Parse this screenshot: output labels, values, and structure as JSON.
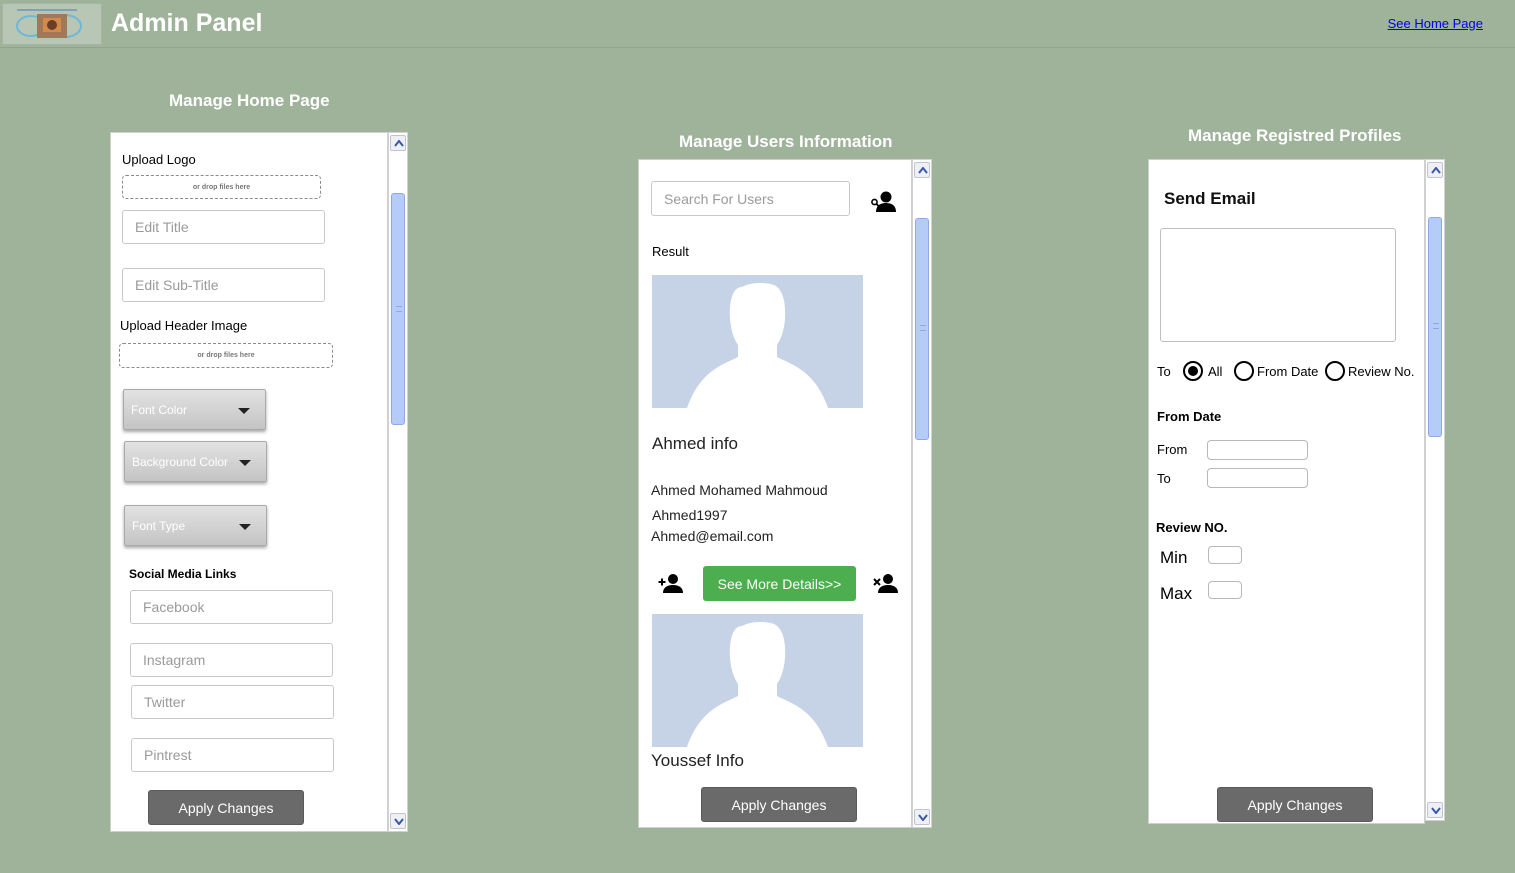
{
  "header": {
    "title": "Admin Panel",
    "home_link": "See Home Page"
  },
  "home_page": {
    "section_title": "Manage Home Page",
    "upload_logo_label": "Upload Logo",
    "dropzone_text": "or drop files here",
    "edit_title_placeholder": "Edit Title",
    "edit_subtitle_placeholder": "Edit Sub-Title",
    "upload_header_label": "Upload Header Image",
    "font_color": "Font Color",
    "background_color": "Background Color",
    "font_type": "Font Type",
    "social_label": "Social Media Links",
    "facebook_placeholder": "Facebook",
    "instagram_placeholder": "Instagram",
    "twitter_placeholder": "Twitter",
    "pintrest_placeholder": "Pintrest",
    "apply_label": "Apply Changes"
  },
  "users": {
    "section_title": "Manage Users Information",
    "search_placeholder": "Search For Users",
    "result_label": "Result",
    "user1": {
      "info_title": "Ahmed info",
      "full_name": "Ahmed Mohamed Mahmoud",
      "username": "Ahmed1997",
      "email": "Ahmed@email.com"
    },
    "see_more_label": "See More Details>>",
    "user2": {
      "info_title": "Youssef Info"
    },
    "apply_label": "Apply Changes"
  },
  "profiles": {
    "section_title": "Manage Registred Profiles",
    "send_email_title": "Send Email",
    "to_label": "To",
    "radio_all": "All",
    "radio_from_date": "From Date",
    "radio_review": "Review No.",
    "from_date_heading": "From Date",
    "from_label": "From",
    "to_date_label": "To",
    "review_heading": "Review NO.",
    "min_label": "Min",
    "max_label": "Max",
    "apply_label": "Apply Changes"
  },
  "colors": {
    "background": "#9fb39a",
    "accent_green": "#4cae4f",
    "button_dark": "#6a6a6a",
    "link": "#0000ee",
    "avatar_bg": "#c6d2e6"
  },
  "icons": {
    "scroll_up": "chevron-up-icon",
    "scroll_down": "chevron-down-icon",
    "search_user": "search-user-icon",
    "add_user": "add-user-icon",
    "remove_user": "remove-user-icon",
    "avatar": "user-silhouette-icon"
  }
}
